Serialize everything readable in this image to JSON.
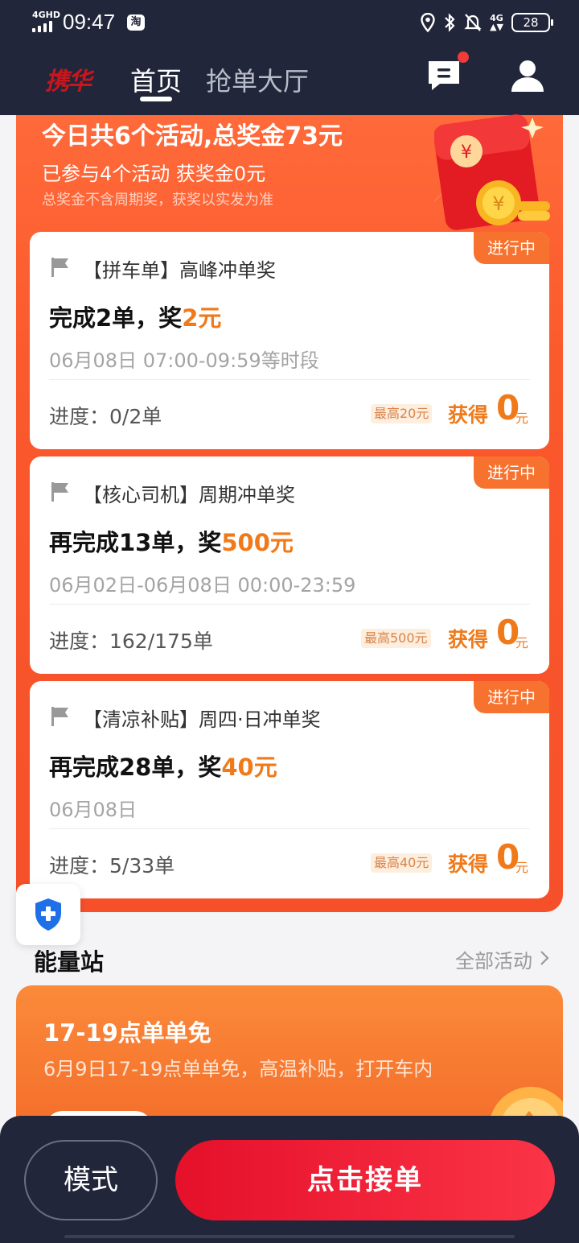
{
  "status_bar": {
    "network_type": "4GHD",
    "time": "09:47",
    "app_icon": "淘",
    "mobile_data": "4G",
    "battery": "28"
  },
  "header": {
    "logo": "携华",
    "tabs": [
      {
        "label": "首页",
        "active": true
      },
      {
        "label": "抢单大厅",
        "active": false
      }
    ]
  },
  "banner": {
    "title": "今日共6个活动,总奖金73元",
    "subtitle": "已参与4个活动 获奖金0元",
    "note": "总奖金不含周期奖，获奖以实发为准"
  },
  "activities": [
    {
      "status": "进行中",
      "title": "【拼车单】高峰冲单奖",
      "goal_prefix": "完成2单，奖",
      "goal_amount": "2元",
      "period": "06月08日 07:00-09:59等时段",
      "progress": "进度：0/2单",
      "max_label": "最高20元",
      "earn_label": "获得",
      "earn_value": "0",
      "earn_unit": "元"
    },
    {
      "status": "进行中",
      "title": "【核心司机】周期冲单奖",
      "goal_prefix": "再完成13单，奖",
      "goal_amount": "500元",
      "period": "06月02日-06月08日 00:00-23:59",
      "progress": "进度：162/175单",
      "max_label": "最高500元",
      "earn_label": "获得",
      "earn_value": "0",
      "earn_unit": "元"
    },
    {
      "status": "进行中",
      "title": "【清凉补贴】周四·日冲单奖",
      "goal_prefix": "再完成28单，奖",
      "goal_amount": "40元",
      "period": "06月08日",
      "progress": "进度：5/33单",
      "max_label": "最高40元",
      "earn_label": "获得",
      "earn_value": "0",
      "earn_unit": "元"
    }
  ],
  "energy_station": {
    "title": "能量站",
    "all_link": "全部活动",
    "card": {
      "title": "17-19点单单免",
      "desc": "6月9日17-19点单单免，高温补贴，打开车内"
    }
  },
  "bottom": {
    "mode_label": "模式",
    "accept_label": "点击接单"
  },
  "colors": {
    "header_bg": "#22263a",
    "panel_orange": "#f6502a",
    "accent_orange": "#f07a1a",
    "accept_red": "#e5102a"
  }
}
